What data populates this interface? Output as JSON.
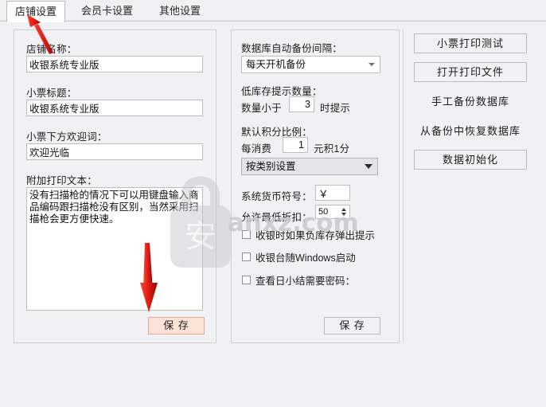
{
  "window": {
    "background_color": "#f1f0f2"
  },
  "tabs": [
    {
      "label": "店铺设置",
      "active": true
    },
    {
      "label": "会员卡设置",
      "active": false
    },
    {
      "label": "其他设置",
      "active": false
    }
  ],
  "shop_panel": {
    "name_label": "店铺名称：",
    "name_value": "收银系统专业版",
    "receipt_title_label": "小票标题：",
    "receipt_title_value": "收银系统专业版",
    "welcome_label": "小票下方欢迎词：",
    "welcome_value": "欢迎光临",
    "extra_text_label": "附加打印文本：",
    "extra_text_value": "没有扫描枪的情况下可以用键盘输入商品编码跟扫描枪没有区别，当然采用扫描枪会更方便快速。",
    "save_label": "保 存"
  },
  "system_panel": {
    "backup_interval_label": "数据库自动备份间隔：",
    "backup_interval_value": "每天开机备份",
    "low_stock_label": "低库存提示数量：",
    "low_stock_prefix": "数量小于",
    "low_stock_value": "3",
    "low_stock_suffix": "时提示",
    "points_ratio_label": "默认积分比例：",
    "points_prefix": "每消费",
    "points_value": "1",
    "points_suffix": "元积1分",
    "points_mode_value": "按类别设置",
    "currency_label": "系统货币符号：",
    "currency_value": "￥",
    "min_discount_label": "允许最低折扣：",
    "min_discount_value": "50",
    "checkbox_negative_stock": "收银时如果负库存弹出提示",
    "checkbox_autostart": "收银台随Windows启动",
    "checkbox_daily_password": "查看日小结需要密码：",
    "save_label": "保 存"
  },
  "actions_panel": {
    "buttons": [
      {
        "label": "小票打印测试",
        "style": "framed"
      },
      {
        "label": "打开打印文件",
        "style": "framed"
      },
      {
        "label": "手工备份数据库",
        "style": "flat"
      },
      {
        "label": "从备份中恢复数据库",
        "style": "flat"
      },
      {
        "label": "数据初始化",
        "style": "framed"
      }
    ]
  },
  "annotations": {
    "arrow_color": "#e02020",
    "arrow_tab_target": "店铺设置",
    "arrow_save_target": "保 存"
  },
  "watermark": {
    "glyph": "安",
    "site": "anxz.com",
    "color": "#c9c9cc"
  }
}
